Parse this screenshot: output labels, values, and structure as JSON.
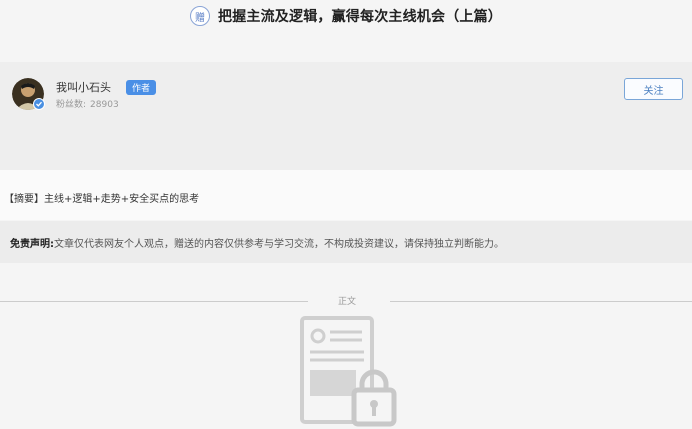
{
  "header": {
    "badge": "赠",
    "title": "把握主流及逻辑，赢得每次主线机会（上篇）"
  },
  "author": {
    "name": "我叫小石头",
    "badge": "作者",
    "fans_label": "粉丝数:",
    "fans_count": "28903",
    "follow_label": "关注"
  },
  "summary": {
    "text": "【摘要】主线+逻辑+走势+安全买点的思考"
  },
  "disclaimer": {
    "label": "免责声明:",
    "text": "文章仅代表网友个人观点，赠送的内容仅供参考与学习交流，不构成投资建议，请保持独立判断能力。"
  },
  "body": {
    "divider_label": "正文"
  },
  "colors": {
    "accent": "#4a8fe6",
    "follow_border": "#7aa6d8"
  },
  "icons": {
    "avatar": "avatar-image",
    "verify": "verified-icon",
    "locked": "locked-document-icon"
  }
}
